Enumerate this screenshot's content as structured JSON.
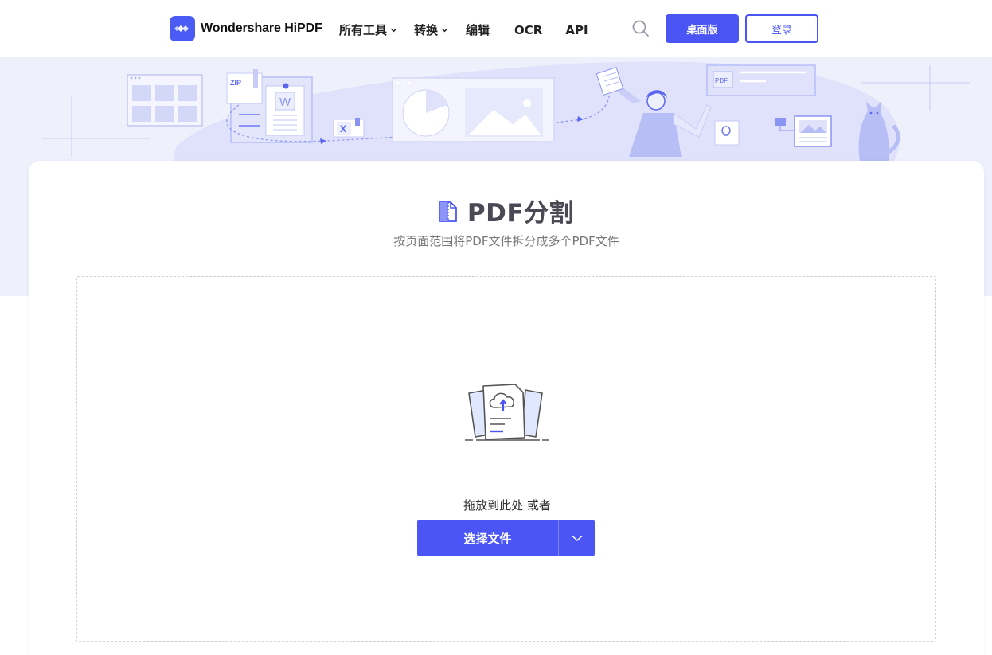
{
  "header": {
    "brand": "Wondershare HiPDF",
    "nav": [
      {
        "label": "所有工具",
        "has_dropdown": true
      },
      {
        "label": "转换",
        "has_dropdown": true
      },
      {
        "label": "编辑",
        "has_dropdown": false
      },
      {
        "label": "OCR",
        "has_dropdown": false
      },
      {
        "label": "API",
        "has_dropdown": false
      }
    ],
    "desktop_button": "桌面版",
    "login_button": "登录"
  },
  "hero": {
    "decorations": [
      "grid-window-illustration",
      "zip-file-illustration",
      "word-file-illustration",
      "excel-file-illustration",
      "chart-window-illustration",
      "person-illustration",
      "pdf-card-illustration",
      "lightbulb-illustration",
      "image-card-illustration",
      "cat-illustration"
    ],
    "badge_zip": "ZIP",
    "badge_word": "W",
    "badge_excel": "X",
    "badge_pdf": "PDF"
  },
  "tool": {
    "title": "PDF分割",
    "subtitle": "按页面范围将PDF文件拆分成多个PDF文件"
  },
  "dropzone": {
    "hint": "拖放到此处 或者",
    "choose_label": "选择文件"
  },
  "colors": {
    "accent": "#4b55f5",
    "hero_bg": "#eef0fc",
    "title": "#4a4a54"
  },
  "icons": {
    "logo": "hipdf-logo-icon",
    "search": "search-icon",
    "chevron": "chevron-down-icon",
    "split": "pdf-split-icon",
    "upload": "cloud-upload-icon"
  }
}
